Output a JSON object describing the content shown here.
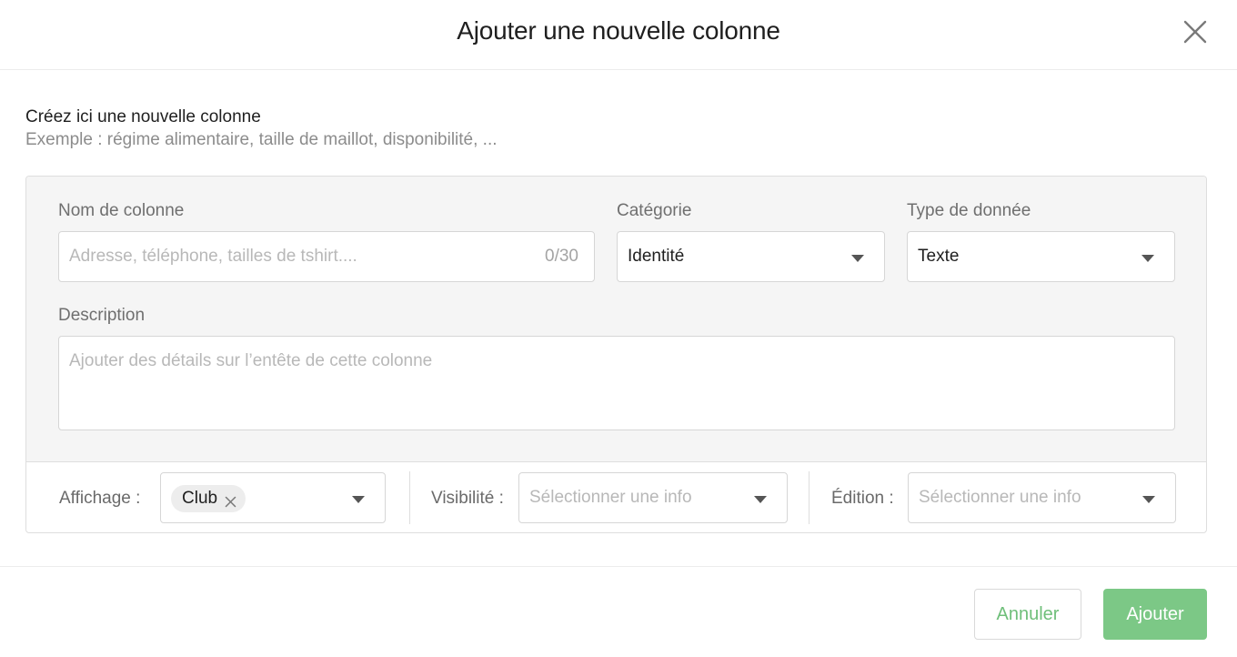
{
  "dialog": {
    "title": "Ajouter une nouvelle colonne"
  },
  "intro": {
    "title": "Créez ici une nouvelle colonne",
    "example": "Exemple : régime alimentaire, taille de maillot, disponibilité, ..."
  },
  "form": {
    "column_name": {
      "label": "Nom de colonne",
      "placeholder": "Adresse, téléphone, tailles de tshirt....",
      "counter": "0/30"
    },
    "category": {
      "label": "Catégorie",
      "value": "Identité"
    },
    "data_type": {
      "label": "Type de donnée",
      "value": "Texte"
    },
    "description": {
      "label": "Description",
      "placeholder": "Ajouter des détails sur l’entête de cette colonne"
    }
  },
  "permissions": {
    "display": {
      "label": "Affichage :",
      "tags": [
        "Club"
      ]
    },
    "visibility": {
      "label": "Visibilité :",
      "placeholder": "Sélectionner une info"
    },
    "edition": {
      "label": "Édition :",
      "placeholder": "Sélectionner une info"
    }
  },
  "footer": {
    "cancel_label": "Annuler",
    "add_label": "Ajouter"
  },
  "colors": {
    "accent_green": "#7cc886",
    "cancel_text_green": "#6fbf7a"
  }
}
